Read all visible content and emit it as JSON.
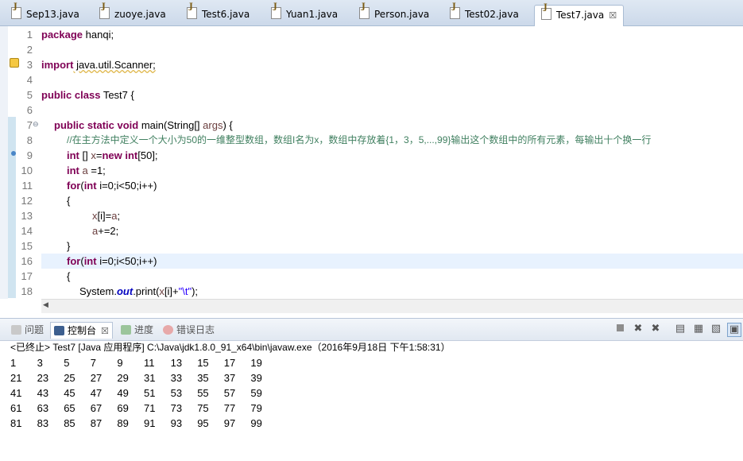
{
  "tabs": [
    {
      "label": "Sep13.java",
      "active": false
    },
    {
      "label": "zuoye.java",
      "active": false
    },
    {
      "label": "Test6.java",
      "active": false
    },
    {
      "label": "Yuan1.java",
      "active": false
    },
    {
      "label": "Person.java",
      "active": false
    },
    {
      "label": "Test02.java",
      "active": false
    },
    {
      "label": "Test7.java",
      "active": true
    }
  ],
  "close_glyph": "☒",
  "line_numbers": [
    "1",
    "2",
    "3",
    "4",
    "5",
    "6",
    "7",
    "8",
    "9",
    "10",
    "11",
    "12",
    "13",
    "14",
    "15",
    "16",
    "17",
    "18"
  ],
  "code": {
    "l1_kw": "package",
    "l1_rest": " hanqi;",
    "l3_kw": "import",
    "l3_rest": " java.util.Scanner;",
    "l5_kw1": "public",
    "l5_kw2": "class",
    "l5_rest": " Test7 {",
    "l7_kw1": "public",
    "l7_kw2": "static",
    "l7_kw3": "void",
    "l7_rest": " main(String[] ",
    "l7_var": "args",
    "l7_end": ") {",
    "l8_comment": "//在主方法中定义一个大小为50的一维整型数组，数组I名为x，数组中存放着{1，3，5,...,99}输出这个数组中的所有元素，每输出十个换一行",
    "l9_kw1": "int",
    "l9_a": " [] ",
    "l9_var": "x",
    "l9_b": "=",
    "l9_kw2": "new",
    "l9_kw3": "int",
    "l9_c": "[50];",
    "l10_kw": "int",
    "l10_a": " ",
    "l10_var": "a",
    "l10_b": " =1;",
    "l11_kw1": "for",
    "l11_a": "(",
    "l11_kw2": "int",
    "l11_b": " i=0;i<50;i++)",
    "l12": "{",
    "l13_var": "x",
    "l13_a": "[i]=",
    "l13_var2": "a",
    "l13_b": ";",
    "l14_var": "a",
    "l14_a": "+=2;",
    "l15": "}",
    "l16_kw1": "for",
    "l16_a": "(",
    "l16_kw2": "int",
    "l16_b": " i=0;i<50;i++)",
    "l17": "{",
    "l18_a": "System.",
    "l18_st": "out",
    "l18_b": ".print(",
    "l18_var": "x",
    "l18_c": "[i]+",
    "l18_str": "\"\\t\"",
    "l18_d": ");"
  },
  "views": {
    "problems": "问题",
    "console": "控制台",
    "progress": "进度",
    "errorlog": "错误日志"
  },
  "console_header": "<已终止> Test7 [Java 应用程序] C:\\Java\\jdk1.8.0_91_x64\\bin\\javaw.exe（2016年9月18日 下午1:58:31）",
  "output_rows": [
    [
      "1",
      "3",
      "5",
      "7",
      "9",
      "11",
      "13",
      "15",
      "17",
      "19"
    ],
    [
      "21",
      "23",
      "25",
      "27",
      "29",
      "31",
      "33",
      "35",
      "37",
      "39"
    ],
    [
      "41",
      "43",
      "45",
      "47",
      "49",
      "51",
      "53",
      "55",
      "57",
      "59"
    ],
    [
      "61",
      "63",
      "65",
      "67",
      "69",
      "71",
      "73",
      "75",
      "77",
      "79"
    ],
    [
      "81",
      "83",
      "85",
      "87",
      "89",
      "91",
      "93",
      "95",
      "97",
      "99"
    ]
  ],
  "colors": {
    "keyword": "#7f0055",
    "comment": "#3f7f5f",
    "local_var": "#6a3e3e",
    "string": "#2a00ff",
    "static_field": "#0000c0"
  }
}
